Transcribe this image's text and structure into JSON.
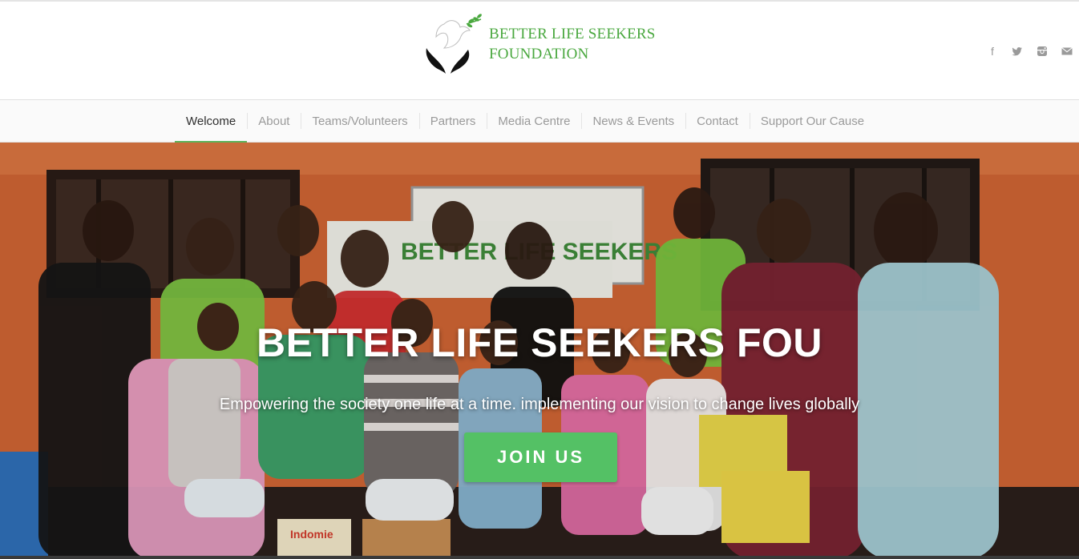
{
  "brand": {
    "name_line1": "BETTER LIFE SEEKERS",
    "name_line2": "FOUNDATION",
    "color": "#4aa83f"
  },
  "social": {
    "icons": [
      "facebook-icon",
      "twitter-icon",
      "instagram-icon",
      "mail-icon"
    ],
    "facebook_glyph": "f",
    "color": "#9a9a9a"
  },
  "nav": {
    "items": [
      {
        "label": "Welcome",
        "active": true
      },
      {
        "label": "About"
      },
      {
        "label": "Teams/Volunteers"
      },
      {
        "label": "Partners"
      },
      {
        "label": "Media Centre"
      },
      {
        "label": "News & Events"
      },
      {
        "label": "Contact"
      },
      {
        "label": "Support Our Cause"
      }
    ],
    "active_underline_color": "#5bb35b"
  },
  "hero": {
    "title": "BETTER LIFE SEEKERS FOU",
    "subtitle": "Empowering the society one life at a time. implementing our vision to change lives globally",
    "button_label": "JOIN US",
    "button_color": "#54c165",
    "banner_text": "BETTER LIFE SEEKERS",
    "box_label": "Indomie"
  }
}
